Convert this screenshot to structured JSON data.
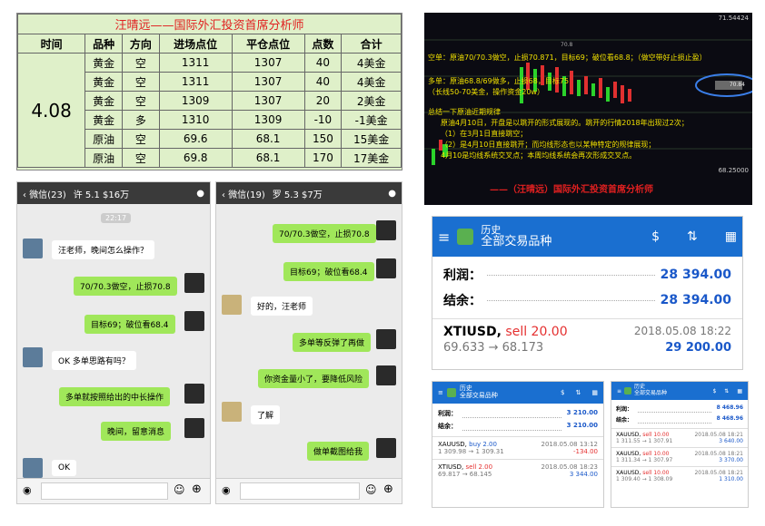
{
  "table": {
    "title": "汪晴远——国际外汇投资首席分析师",
    "headers": [
      "时间",
      "品种",
      "方向",
      "进场点位",
      "平仓点位",
      "点数",
      "合计"
    ],
    "date": "4.08",
    "rows": [
      [
        "黄金",
        "空",
        "1311",
        "1307",
        "40",
        "4美金"
      ],
      [
        "黄金",
        "空",
        "1311",
        "1307",
        "40",
        "4美金"
      ],
      [
        "黄金",
        "空",
        "1309",
        "1307",
        "20",
        "2美金"
      ],
      [
        "黄金",
        "多",
        "1310",
        "1309",
        "-10",
        "-1美金"
      ],
      [
        "原油",
        "空",
        "69.6",
        "68.1",
        "150",
        "15美金"
      ],
      [
        "原油",
        "空",
        "69.8",
        "68.1",
        "170",
        "17美金"
      ]
    ]
  },
  "chart": {
    "price_top": "71.54424",
    "price_tag": "70.8",
    "price_right": "70.84",
    "price_bottom": "68.25000",
    "line1": "空单：原油70/70.3做空，止损70.871，目标69；破位看68.8；（做空带好止损止盈）",
    "line2": "多单：原油68.8/69做多，止损68，目标75",
    "line3": "（长线50-70美金，操作资金20w）",
    "line4": "总结一下原油近期规律",
    "line5": "原油4月10日，开盘是以跳开的形式展现的。跳开的行情2018年出现过2次；",
    "line6": "（1）在3月1日直接跳空；",
    "line7": "（2）是4月10日直接跳开；而均线形态也以某种特定的规律展现；",
    "line8": "4月10是均线系统交叉点；本周均线系统会再次形成交叉点。",
    "signature": "——（汪晴远）国际外汇投资首席分析师"
  },
  "chat1": {
    "back": "微信(23)",
    "name": "许 5.1 $16万",
    "time": "22:17",
    "msgs": [
      "汪老师，晚间怎么操作？",
      "70/70.3做空，止损70.8",
      "目标69；破位看68.4",
      "OK 多单思路有吗？",
      "多单就按照给出的中长操作",
      "晚间，留意消息",
      "OK"
    ]
  },
  "chat2": {
    "back": "微信(19)",
    "name": "罗 5.3 $7万",
    "msgs": [
      "70/70.3做空，止损70.8",
      "目标69；破位看68.4",
      "好的，汪老师",
      "多单等反弹了再做",
      "你资金量小了，要降低风险",
      "了解",
      "做单截图给我"
    ]
  },
  "hist_big": {
    "title": "历史",
    "subtitle": "全部交易品种",
    "profit_label": "利润：",
    "profit": "28 394.00",
    "balance_label": "结余：",
    "balance": "28 394.00",
    "symbol": "XTIUSD,",
    "action": "sell 20.00",
    "date": "2018.05.08 18:22",
    "prices": "69.633 → 68.173",
    "pl": "29 200.00"
  },
  "hist_small1": {
    "title": "历史",
    "subtitle": "全部交易品种",
    "profit_label": "利润：",
    "profit": "3 210.00",
    "balance_label": "结余：",
    "balance": "3 210.00",
    "trades": [
      {
        "symbol": "XAUUSD,",
        "action": "buy 2.00",
        "date": "2018.05.08 13:12",
        "prices": "1 309.98 → 1 309.31",
        "pl": "-134.00"
      },
      {
        "symbol": "XTIUSD,",
        "action": "sell 2.00",
        "date": "2018.05.08 18:23",
        "prices": "69.817 → 68.145",
        "pl": "3 344.00"
      }
    ]
  },
  "hist_small2": {
    "title": "历史",
    "subtitle": "全部交易品种",
    "profit_label": "利润：",
    "profit": "8 468.96",
    "balance_label": "结余：",
    "balance": "8 468.96",
    "trades": [
      {
        "symbol": "XAUUSD,",
        "action": "sell 10.00",
        "date": "2018.05.08 18:21",
        "prices": "1 311.55 → 1 307.91",
        "pl": "3 640.00"
      },
      {
        "symbol": "XAUUSD,",
        "action": "sell 10.00",
        "date": "2018.05.08 18:21",
        "prices": "1 311.34 → 1 307.97",
        "pl": "3 370.00"
      },
      {
        "symbol": "XAUUSD,",
        "action": "sell 10.00",
        "date": "2018.05.08 18:21",
        "prices": "1 309.40 → 1 308.09",
        "pl": "1 310.00"
      }
    ]
  }
}
